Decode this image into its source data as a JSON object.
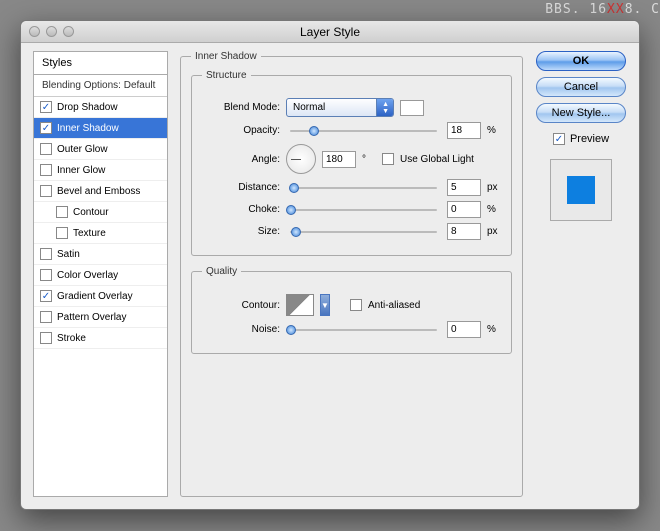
{
  "watermark": {
    "pre": "BBS. 16",
    "mid": "XX",
    "post": "8. C"
  },
  "window": {
    "title": "Layer Style"
  },
  "styles": {
    "header": "Styles",
    "subheader": "Blending Options: Default",
    "items": [
      {
        "label": "Drop Shadow",
        "checked": true,
        "selected": false,
        "indent": false
      },
      {
        "label": "Inner Shadow",
        "checked": true,
        "selected": true,
        "indent": false
      },
      {
        "label": "Outer Glow",
        "checked": false,
        "selected": false,
        "indent": false
      },
      {
        "label": "Inner Glow",
        "checked": false,
        "selected": false,
        "indent": false
      },
      {
        "label": "Bevel and Emboss",
        "checked": false,
        "selected": false,
        "indent": false
      },
      {
        "label": "Contour",
        "checked": false,
        "selected": false,
        "indent": true
      },
      {
        "label": "Texture",
        "checked": false,
        "selected": false,
        "indent": true
      },
      {
        "label": "Satin",
        "checked": false,
        "selected": false,
        "indent": false
      },
      {
        "label": "Color Overlay",
        "checked": false,
        "selected": false,
        "indent": false
      },
      {
        "label": "Gradient Overlay",
        "checked": true,
        "selected": false,
        "indent": false
      },
      {
        "label": "Pattern Overlay",
        "checked": false,
        "selected": false,
        "indent": false
      },
      {
        "label": "Stroke",
        "checked": false,
        "selected": false,
        "indent": false
      }
    ]
  },
  "panel": {
    "title": "Inner Shadow",
    "structure": {
      "legend": "Structure",
      "blend_label": "Blend Mode:",
      "blend_value": "Normal",
      "opacity_label": "Opacity:",
      "opacity_value": "18",
      "opacity_unit": "%",
      "angle_label": "Angle:",
      "angle_value": "180",
      "angle_unit": "°",
      "global_light": "Use Global Light",
      "distance_label": "Distance:",
      "distance_value": "5",
      "distance_unit": "px",
      "choke_label": "Choke:",
      "choke_value": "0",
      "choke_unit": "%",
      "size_label": "Size:",
      "size_value": "8",
      "size_unit": "px"
    },
    "quality": {
      "legend": "Quality",
      "contour_label": "Contour:",
      "antialias": "Anti-aliased",
      "noise_label": "Noise:",
      "noise_value": "0",
      "noise_unit": "%"
    }
  },
  "buttons": {
    "ok": "OK",
    "cancel": "Cancel",
    "newstyle": "New Style...",
    "preview": "Preview"
  },
  "colors": {
    "preview_swatch": "#0d7fe0"
  }
}
